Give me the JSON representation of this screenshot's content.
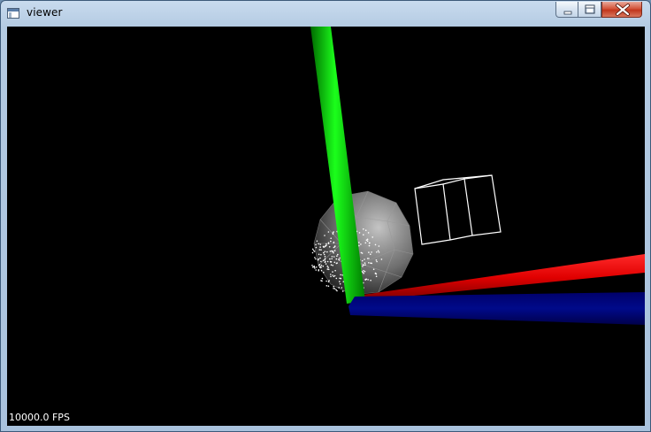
{
  "window": {
    "title": "viewer",
    "icon": "app-window-icon",
    "controls": {
      "minimize_icon": "minimize-icon",
      "maximize_icon": "restore-icon",
      "close_icon": "close-icon"
    }
  },
  "viewport": {
    "background": "#000000",
    "fps_text": "10000.0 FPS",
    "axes": {
      "x_color": "#ff0000",
      "y_color": "#00dd00",
      "z_color": "#000080"
    },
    "objects": [
      "green-axis-cylinder",
      "red-axis-cylinder",
      "blue-axis-cylinder",
      "translucent-sphere",
      "point-cloud",
      "wireframe-cube"
    ]
  }
}
